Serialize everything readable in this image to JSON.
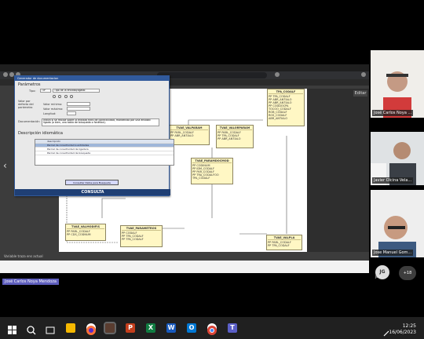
{
  "dialog": {
    "title": "Generador de documentacion",
    "section_parameters": "Parámetros",
    "field_tipo_label": "Tipo:",
    "field_tipo_value": "TIP",
    "field_tipo_desc": "Tipo de la entidad/ligado",
    "field_valor_defecto": "Valor por defecto del parámetro",
    "field_valor_minimo": "Valor mínimo:",
    "field_valor_maximo": "Valor máximo:",
    "field_longitud": "Longitud:",
    "field_documentacion": "Documentación",
    "doc_text": "Indica si se realiza sobre la entidad filtro de conectividad, mantenida por una entidad ligada (o bien, una tabla de búsqueda o fonética).",
    "section_descripcion": "Descripción idiomática",
    "list_header": "descripción",
    "list_rows": [
      "Parcial de conectividad a entidades",
      "Parcial de conectividad de ligadura",
      "Parcial de conectividad de búsqueda"
    ],
    "consulta": "CONSULTA",
    "dlg_button": "Consultar Datos para Busqueda"
  },
  "diagram": {
    "entities": [
      {
        "title": "TVAE_VALPARAM",
        "rows": [
          "PP  PARL_CODALF",
          "PP  ABR_ANTIALO"
        ]
      },
      {
        "title": "TVAE_VALORPARAM",
        "rows": [
          "PP  PARL_CODALF",
          "PP  TPA_CODALF",
          "PP  ABR_ANTIALO"
        ]
      },
      {
        "title": "TPA_CODALF",
        "rows": [
          "PP  TPA_CODALF",
          "PP  ABR_ANTIALO",
          "PP  ABR_ANTIALO",
          "PP  CODDOCPA",
          "    TOCOO_CODALF",
          "    ROB_CODALF",
          "    ROS_CODALF",
          "    ABR_ANTIALO"
        ]
      },
      {
        "title": "TVAE_PARAMDOCMOD",
        "rows": [
          "PP  CODINUM",
          "PP  IDM_CODALF",
          "PP  PAR_CODALF",
          "PP  TRA_CODALFOO",
          "    TPA_CODALF"
        ]
      },
      {
        "title": "TVAE_VALMODIFIS",
        "rows": [
          "PP  PARL_CODALF",
          "PP  CDS_CODNUM"
        ]
      },
      {
        "title": "TVAE_PARAMETROS",
        "rows": [
          "PP  CODALF",
          "PP  TPA_CODALF",
          "PP  TPA_CODALF"
        ]
      },
      {
        "title": "TVAE_VALPLA",
        "rows": [
          "PP  PARL_CODALF",
          "PP  TPA_CODALF",
          "PP  TPA_CODALF"
        ]
      }
    ]
  },
  "browser": {
    "editar_label": "Editar",
    "status_text": "Variable traza ens actual"
  },
  "participants": [
    {
      "name": "José Carlos Noya ..."
    },
    {
      "name": "Javier Olcina Vela..."
    },
    {
      "name": "Jose Manuel Gom..."
    }
  ],
  "avatar_initials": "JG",
  "avatar_label": "José ...",
  "more_count": "+18",
  "presenter": "José Carlos Noya Mendoza",
  "clock": {
    "time": "12:25",
    "date": "16/06/2023"
  },
  "colors": {
    "accent": "#5e5ebd",
    "dialog_title": "#315a9c",
    "entity_fill": "#fff7c4"
  }
}
